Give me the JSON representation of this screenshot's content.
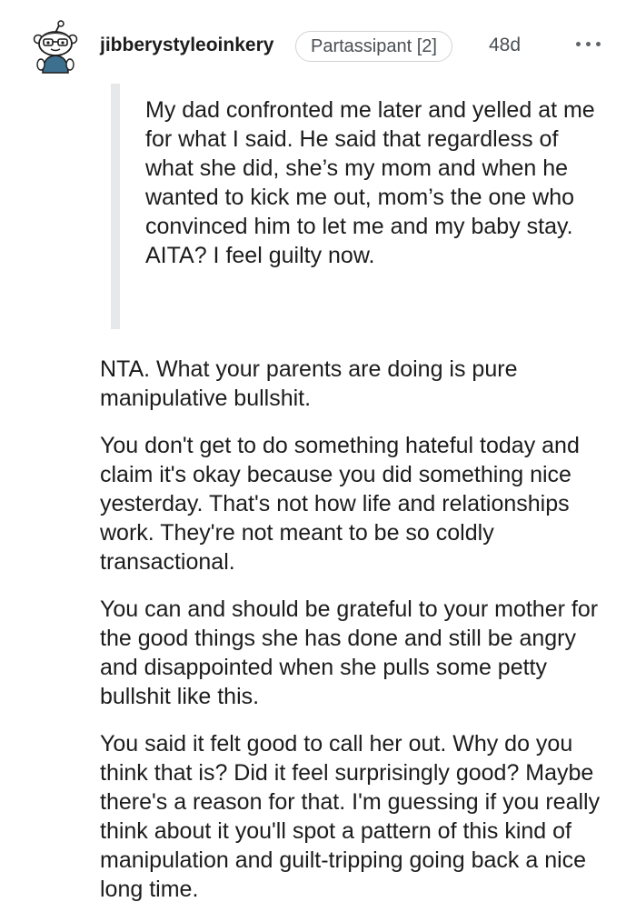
{
  "comment": {
    "author": "jibberystyleoinkery",
    "flair": "Partassipant [2]",
    "age": "48d",
    "avatar": "snoo-avatar-icon",
    "more_icon": "more-options-icon",
    "quote": "My dad confronted me later and yelled at me for what I said. He said that regardless of what she did, she’s my mom and when he wanted to kick me out, mom’s the one who convinced him to let me and my baby stay. AITA? I feel guilty now.",
    "paragraphs": [
      "NTA. What your parents are doing is pure manipulative bullshit.",
      "You don't get to do something hateful today and claim it's okay because you did something nice yesterday. That's not how life and relationships work. They're not meant to be so coldly transactional.",
      "You can and should be grateful to your mother for the good things she has done and still be angry and disappointed when she pulls some petty bullshit like this.",
      "You said it felt good to call her out. Why do you think that is? Did it feel surprisingly good? Maybe there's a reason for that. I'm guessing if you really think about it you'll spot a pattern of this kind of manipulation and guilt-tripping going back a nice long time."
    ]
  },
  "colors": {
    "text": "#1c1c1c",
    "meta": "#4a4f53",
    "quote_bar": "#e6e8ea",
    "flair_border": "#cfd3d6"
  }
}
